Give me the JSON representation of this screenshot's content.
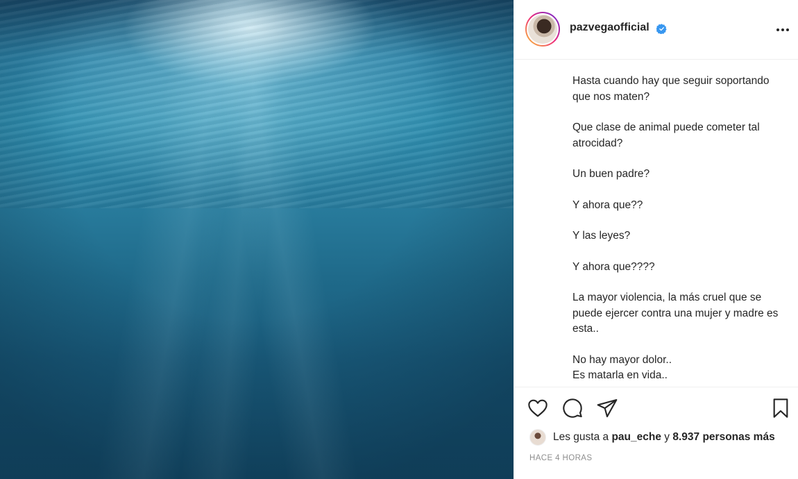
{
  "post": {
    "username": "pazvegaofficial",
    "verified": true,
    "caption": [
      "Hasta cuando hay que seguir soportando que nos maten?",
      "Que clase de animal puede cometer tal atrocidad?",
      "Un buen padre?",
      "Y ahora que??",
      "Y las leyes?",
      "Y ahora que????",
      "La mayor violencia, la más cruel que se puede ejercer contra una mujer y madre es esta..",
      "No hay mayor dolor..\nEs matarla en vida.."
    ],
    "likes": {
      "prefix": "Les gusta a",
      "first_user": "pau_eche",
      "connector": "y",
      "others": "8.937 personas más"
    },
    "time_ago": "HACE 4 HORAS"
  },
  "icons": {
    "more": "more-options-icon",
    "like": "heart-icon",
    "comment": "comment-icon",
    "share": "paper-plane-icon",
    "save": "bookmark-icon",
    "verified": "verified-badge-icon"
  },
  "colors": {
    "text": "#262626",
    "muted": "#8e8e8e",
    "verified": "#3897f0",
    "water_top": "#2d84a8",
    "water_bottom": "#154e6c"
  }
}
